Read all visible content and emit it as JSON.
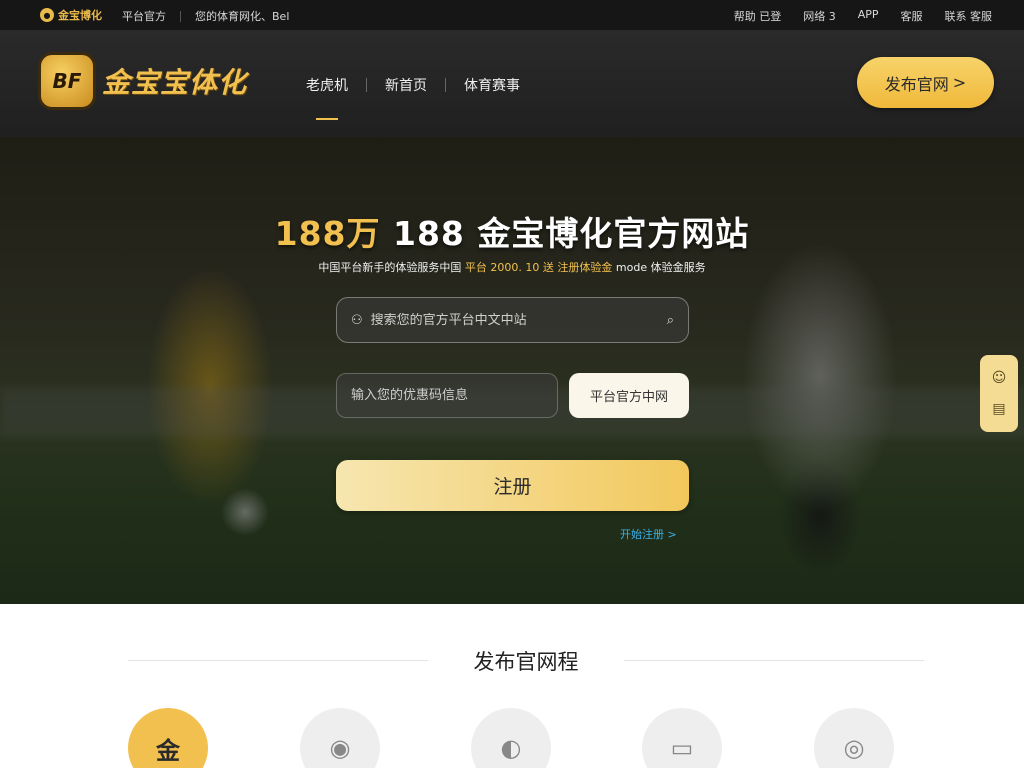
{
  "topbar": {
    "mini_logo": "金宝博化",
    "left_links": [
      "平台官方",
      "您的体育网化、Bel"
    ],
    "right_links": [
      "帮助 已登",
      "网络 3",
      "APP",
      "客服",
      "联系 客服"
    ]
  },
  "header": {
    "logo_mark": "BF",
    "logo_text": "金宝宝体化",
    "nav": [
      "老虎机",
      "新首页",
      "体育赛事"
    ],
    "cta": "发布官网",
    "cta_arrow": ">"
  },
  "hero": {
    "title_gold": "188万",
    "title_white": "188 金宝博化官方网站",
    "subtitle_pre": "中国平台新手的体验服务中国",
    "subtitle_gold": "平台 2000. 10 送",
    "subtitle_gold2": "注册体验金",
    "subtitle_post": "mode 体验金服务",
    "search_placeholder": "搜索您的官方平台中文中站",
    "search_icon": "search-icon",
    "user_icon": "user-icon",
    "code_placeholder": "输入您的优惠码信息",
    "code_button": "平台官方中网",
    "register": "注册",
    "link": "开始注册 >"
  },
  "side_widget": {
    "icons": [
      "chat-icon",
      "app-icon"
    ]
  },
  "section": {
    "title": "发布官网程",
    "circles": [
      "金",
      "",
      "",
      "",
      ""
    ]
  },
  "colors": {
    "accent": "#f2c04f",
    "dark": "#202020",
    "link": "#3ab0e8"
  }
}
